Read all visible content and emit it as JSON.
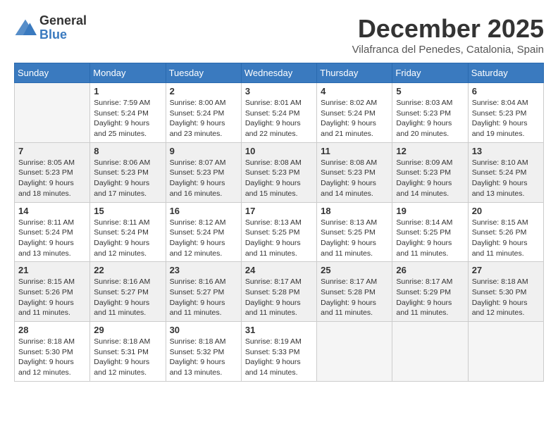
{
  "logo": {
    "general": "General",
    "blue": "Blue"
  },
  "title": "December 2025",
  "location": "Vilafranca del Penedes, Catalonia, Spain",
  "headers": [
    "Sunday",
    "Monday",
    "Tuesday",
    "Wednesday",
    "Thursday",
    "Friday",
    "Saturday"
  ],
  "weeks": [
    [
      {
        "day": "",
        "empty": true
      },
      {
        "day": "1",
        "sunrise": "7:59 AM",
        "sunset": "5:24 PM",
        "daylight": "9 hours and 25 minutes."
      },
      {
        "day": "2",
        "sunrise": "8:00 AM",
        "sunset": "5:24 PM",
        "daylight": "9 hours and 23 minutes."
      },
      {
        "day": "3",
        "sunrise": "8:01 AM",
        "sunset": "5:24 PM",
        "daylight": "9 hours and 22 minutes."
      },
      {
        "day": "4",
        "sunrise": "8:02 AM",
        "sunset": "5:24 PM",
        "daylight": "9 hours and 21 minutes."
      },
      {
        "day": "5",
        "sunrise": "8:03 AM",
        "sunset": "5:23 PM",
        "daylight": "9 hours and 20 minutes."
      },
      {
        "day": "6",
        "sunrise": "8:04 AM",
        "sunset": "5:23 PM",
        "daylight": "9 hours and 19 minutes."
      }
    ],
    [
      {
        "day": "7",
        "sunrise": "8:05 AM",
        "sunset": "5:23 PM",
        "daylight": "9 hours and 18 minutes."
      },
      {
        "day": "8",
        "sunrise": "8:06 AM",
        "sunset": "5:23 PM",
        "daylight": "9 hours and 17 minutes."
      },
      {
        "day": "9",
        "sunrise": "8:07 AM",
        "sunset": "5:23 PM",
        "daylight": "9 hours and 16 minutes."
      },
      {
        "day": "10",
        "sunrise": "8:08 AM",
        "sunset": "5:23 PM",
        "daylight": "9 hours and 15 minutes."
      },
      {
        "day": "11",
        "sunrise": "8:08 AM",
        "sunset": "5:23 PM",
        "daylight": "9 hours and 14 minutes."
      },
      {
        "day": "12",
        "sunrise": "8:09 AM",
        "sunset": "5:23 PM",
        "daylight": "9 hours and 14 minutes."
      },
      {
        "day": "13",
        "sunrise": "8:10 AM",
        "sunset": "5:24 PM",
        "daylight": "9 hours and 13 minutes."
      }
    ],
    [
      {
        "day": "14",
        "sunrise": "8:11 AM",
        "sunset": "5:24 PM",
        "daylight": "9 hours and 13 minutes."
      },
      {
        "day": "15",
        "sunrise": "8:11 AM",
        "sunset": "5:24 PM",
        "daylight": "9 hours and 12 minutes."
      },
      {
        "day": "16",
        "sunrise": "8:12 AM",
        "sunset": "5:24 PM",
        "daylight": "9 hours and 12 minutes."
      },
      {
        "day": "17",
        "sunrise": "8:13 AM",
        "sunset": "5:25 PM",
        "daylight": "9 hours and 11 minutes."
      },
      {
        "day": "18",
        "sunrise": "8:13 AM",
        "sunset": "5:25 PM",
        "daylight": "9 hours and 11 minutes."
      },
      {
        "day": "19",
        "sunrise": "8:14 AM",
        "sunset": "5:25 PM",
        "daylight": "9 hours and 11 minutes."
      },
      {
        "day": "20",
        "sunrise": "8:15 AM",
        "sunset": "5:26 PM",
        "daylight": "9 hours and 11 minutes."
      }
    ],
    [
      {
        "day": "21",
        "sunrise": "8:15 AM",
        "sunset": "5:26 PM",
        "daylight": "9 hours and 11 minutes."
      },
      {
        "day": "22",
        "sunrise": "8:16 AM",
        "sunset": "5:27 PM",
        "daylight": "9 hours and 11 minutes."
      },
      {
        "day": "23",
        "sunrise": "8:16 AM",
        "sunset": "5:27 PM",
        "daylight": "9 hours and 11 minutes."
      },
      {
        "day": "24",
        "sunrise": "8:17 AM",
        "sunset": "5:28 PM",
        "daylight": "9 hours and 11 minutes."
      },
      {
        "day": "25",
        "sunrise": "8:17 AM",
        "sunset": "5:28 PM",
        "daylight": "9 hours and 11 minutes."
      },
      {
        "day": "26",
        "sunrise": "8:17 AM",
        "sunset": "5:29 PM",
        "daylight": "9 hours and 11 minutes."
      },
      {
        "day": "27",
        "sunrise": "8:18 AM",
        "sunset": "5:30 PM",
        "daylight": "9 hours and 12 minutes."
      }
    ],
    [
      {
        "day": "28",
        "sunrise": "8:18 AM",
        "sunset": "5:30 PM",
        "daylight": "9 hours and 12 minutes."
      },
      {
        "day": "29",
        "sunrise": "8:18 AM",
        "sunset": "5:31 PM",
        "daylight": "9 hours and 12 minutes."
      },
      {
        "day": "30",
        "sunrise": "8:18 AM",
        "sunset": "5:32 PM",
        "daylight": "9 hours and 13 minutes."
      },
      {
        "day": "31",
        "sunrise": "8:19 AM",
        "sunset": "5:33 PM",
        "daylight": "9 hours and 14 minutes."
      },
      {
        "day": "",
        "empty": true
      },
      {
        "day": "",
        "empty": true
      },
      {
        "day": "",
        "empty": true
      }
    ]
  ]
}
